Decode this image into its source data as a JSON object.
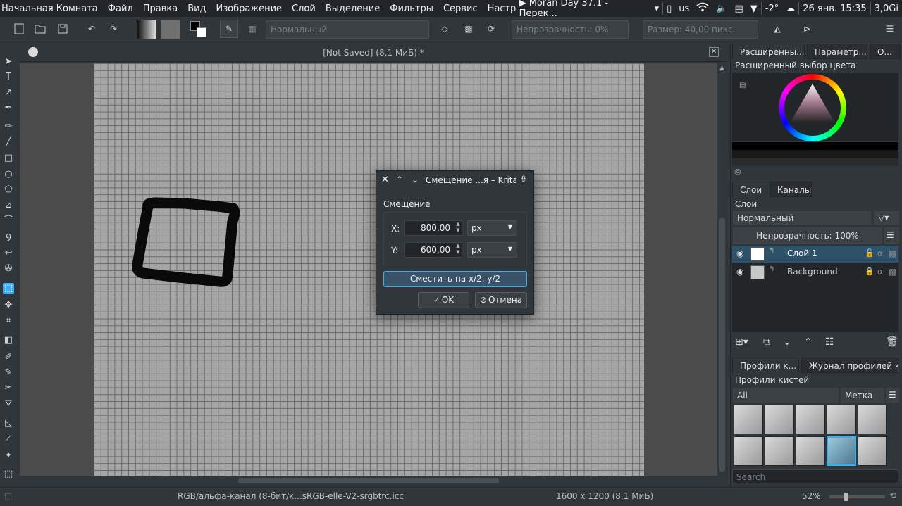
{
  "menubar": {
    "app_name": "Начальная Комната",
    "items": [
      "Файл",
      "Правка",
      "Вид",
      "Изображение",
      "Слой",
      "Выделение",
      "Фильтры",
      "Сервис",
      "Настройк"
    ],
    "media": "▶ Moran Day 37.1 - Перек...",
    "kbd_layout": "us",
    "temperature": "-2°",
    "datetime": "26 янв. 15:35",
    "memory": "3,0Gi"
  },
  "toolbar": {
    "blend_mode": "Нормальный",
    "opacity": "Непрозрачность:  0%",
    "size": "Размер:  40,00 пикс."
  },
  "document": {
    "title": "[Not Saved]  (8,1 МиБ) *"
  },
  "status": {
    "color_profile": "RGB/альфа-канал (8-бит/к...sRGB-elle-V2-srgbtrc.icc",
    "image_size": "1600 x 1200 (8,1 МиБ)",
    "zoom": "52%"
  },
  "dock": {
    "top_tabs": [
      "Расширенны...",
      "Параметр...",
      "О..."
    ],
    "color_selector_title": "Расширенный выбор цвета",
    "layer_tabs": [
      "Слои",
      "Каналы"
    ],
    "layers_title": "Слои",
    "layer_blend": "Нормальный",
    "layer_opacity": "Непрозрачность:  100%",
    "layers": [
      {
        "name": "Слой 1"
      },
      {
        "name": "Background"
      }
    ],
    "brush_tabs": [
      "Профили к...",
      "Журнал профилей к..."
    ],
    "brush_title": "Профили кистей",
    "brush_filter": "All",
    "brush_tag": "Метка",
    "search_placeholder": "Search"
  },
  "dialog": {
    "title": "Смещение ...я – Krita",
    "group_label": "Смещение",
    "x_label": "X:",
    "x_value": "800,00",
    "x_unit": "px",
    "y_label": "Y:",
    "y_value": "600,00",
    "y_unit": "px",
    "half_button": "Сместить на x/2, y/2",
    "ok_button": "OK",
    "cancel_button": "Отмена"
  },
  "colors": {
    "accent": "#3daee9",
    "window_bg": "#31363b",
    "dark_bg": "#232629"
  }
}
